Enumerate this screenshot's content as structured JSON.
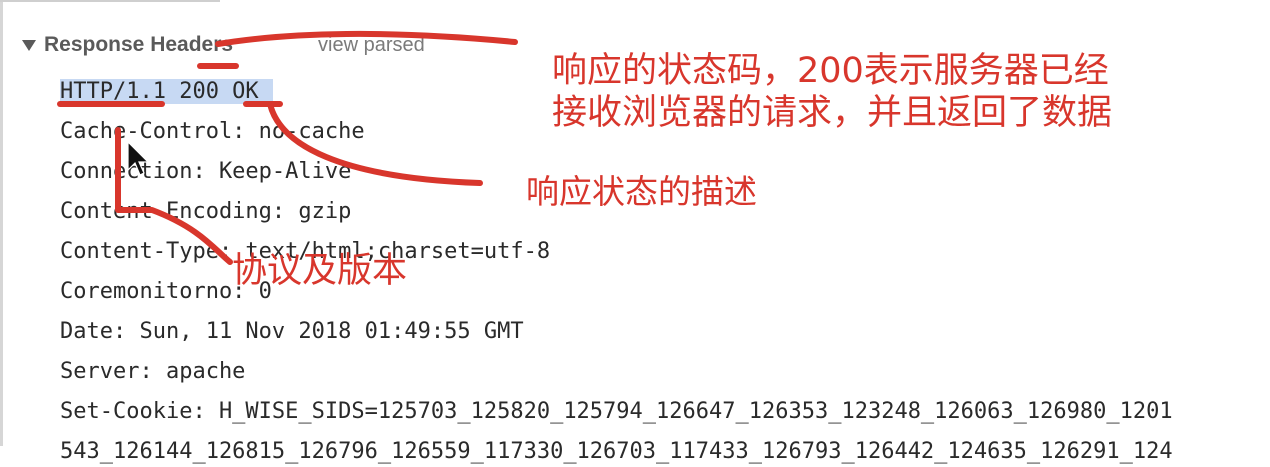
{
  "section": {
    "title": "Response Headers",
    "toggle_label": "view parsed"
  },
  "headers": {
    "status_line": "HTTP/1.1 200 OK",
    "rows": [
      "Cache-Control: no-cache",
      "Connection: Keep-Alive",
      "Content-Encoding: gzip",
      "Content-Type: text/html;charset=utf-8",
      "Coremonitorno: 0",
      "Date: Sun, 11 Nov 2018 01:49:55 GMT",
      "Server: apache",
      "Set-Cookie: H_WISE_SIDS=125703_125820_125794_126647_126353_123248_126063_126980_1201",
      "543_126144_126815_126796_126559_117330_126703_117433_126793_126442_124635_126291_124"
    ]
  },
  "annotations": {
    "status_code_note_line1": "响应的状态码，200表示服务器已经",
    "status_code_note_line2": "接收浏览器的请求，并且返回了数据",
    "description_note": "响应状态的描述",
    "protocol_note": "协议及版本"
  },
  "colors": {
    "annotation": "#d8362c",
    "selection": "#c7d9f3"
  }
}
